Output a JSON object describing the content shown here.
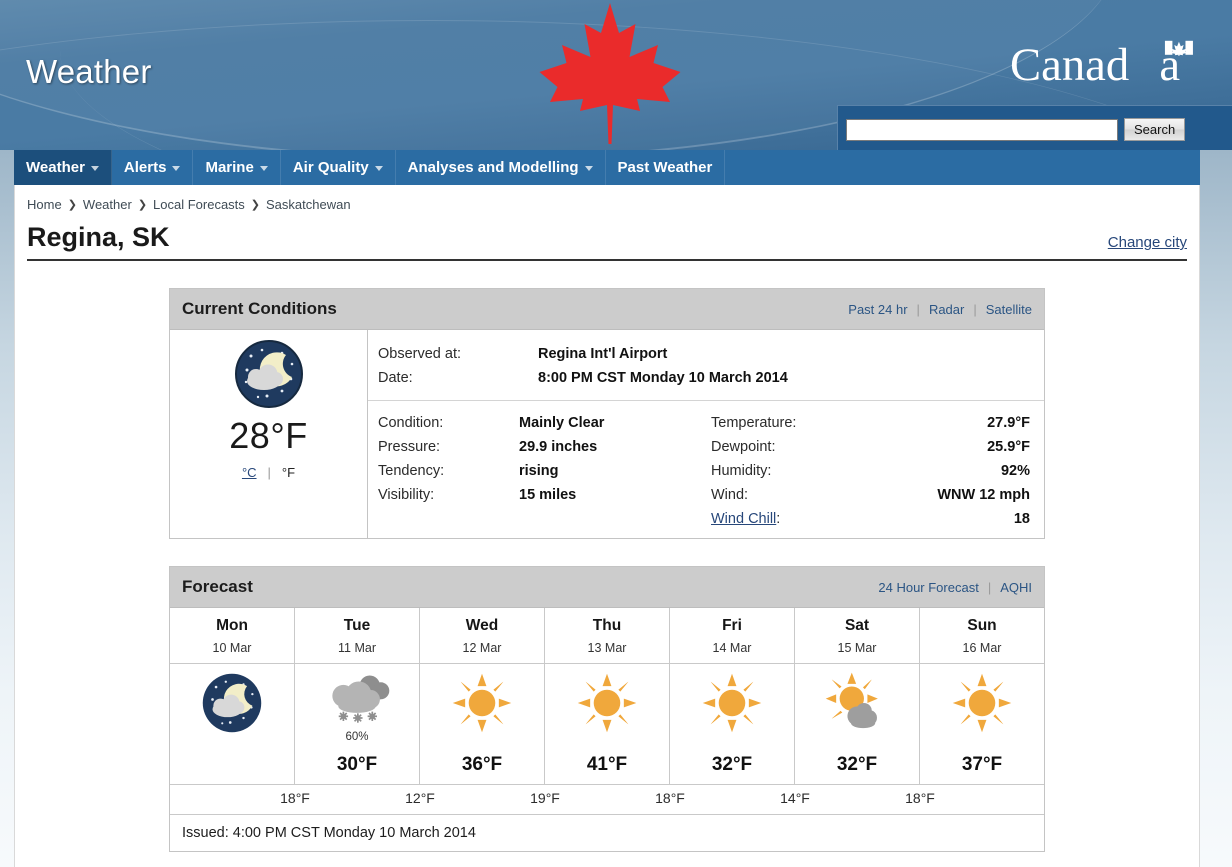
{
  "banner": {
    "title": "Weather",
    "wordmark": "Canada",
    "maple_leaf_color": "#ea2b2b"
  },
  "search": {
    "value": "",
    "placeholder": "",
    "button_label": "Search"
  },
  "nav": {
    "items": [
      {
        "label": "Weather",
        "has_caret": true,
        "active": true
      },
      {
        "label": "Alerts",
        "has_caret": true,
        "active": false
      },
      {
        "label": "Marine",
        "has_caret": true,
        "active": false
      },
      {
        "label": "Air Quality",
        "has_caret": true,
        "active": false
      },
      {
        "label": "Analyses and Modelling",
        "has_caret": true,
        "active": false
      },
      {
        "label": "Past Weather",
        "has_caret": false,
        "active": false
      }
    ]
  },
  "breadcrumb": {
    "items": [
      "Home",
      "Weather",
      "Local Forecasts",
      "Saskatchewan"
    ],
    "separator": "❯"
  },
  "page": {
    "title": "Regina, SK",
    "change_city": "Change city"
  },
  "current_conditions": {
    "heading": "Current Conditions",
    "links": [
      "Past 24 hr",
      "Radar",
      "Satellite"
    ],
    "icon": "night-partly-cloudy-icon",
    "big_temperature": "28°F",
    "unit_celsius": "°C",
    "unit_fahrenheit": "°F",
    "observed_at_label": "Observed at:",
    "observed_at_value": "Regina Int'l Airport",
    "date_label": "Date:",
    "date_value": "8:00 PM CST Monday 10 March 2014",
    "left_rows": [
      {
        "label": "Condition:",
        "value": "Mainly Clear"
      },
      {
        "label": "Pressure:",
        "value": "29.9 inches"
      },
      {
        "label": "Tendency:",
        "value": "rising"
      },
      {
        "label": "Visibility:",
        "value": "15 miles"
      }
    ],
    "right_rows": [
      {
        "label": "Temperature:",
        "value": "27.9°F",
        "link": false
      },
      {
        "label": "Dewpoint:",
        "value": "25.9°F",
        "link": false
      },
      {
        "label": "Humidity:",
        "value": "92%",
        "link": false
      },
      {
        "label": "Wind:",
        "value": "WNW 12 mph",
        "link": false
      },
      {
        "label": "Wind Chill",
        "value": "18",
        "link": true,
        "suffix": ":"
      }
    ]
  },
  "forecast": {
    "heading": "Forecast",
    "links": [
      "24 Hour Forecast",
      "AQHI"
    ],
    "days": [
      {
        "dow": "Mon",
        "date": "10 Mar",
        "icon": "night-partly-cloudy-icon",
        "pop": "",
        "high": ""
      },
      {
        "dow": "Tue",
        "date": "11 Mar",
        "icon": "snow-icon",
        "pop": "60%",
        "high": "30°F"
      },
      {
        "dow": "Wed",
        "date": "12 Mar",
        "icon": "sunny-icon",
        "pop": "",
        "high": "36°F"
      },
      {
        "dow": "Thu",
        "date": "13 Mar",
        "icon": "sunny-icon",
        "pop": "",
        "high": "41°F"
      },
      {
        "dow": "Fri",
        "date": "14 Mar",
        "icon": "sunny-icon",
        "pop": "",
        "high": "32°F"
      },
      {
        "dow": "Sat",
        "date": "15 Mar",
        "icon": "sun-cloud-icon",
        "pop": "",
        "high": "32°F"
      },
      {
        "dow": "Sun",
        "date": "16 Mar",
        "icon": "sunny-icon",
        "pop": "",
        "high": "37°F"
      }
    ],
    "lows": [
      "18°F",
      "12°F",
      "19°F",
      "18°F",
      "14°F",
      "18°F"
    ],
    "issued": "Issued: 4:00 PM CST Monday 10 March 2014"
  }
}
